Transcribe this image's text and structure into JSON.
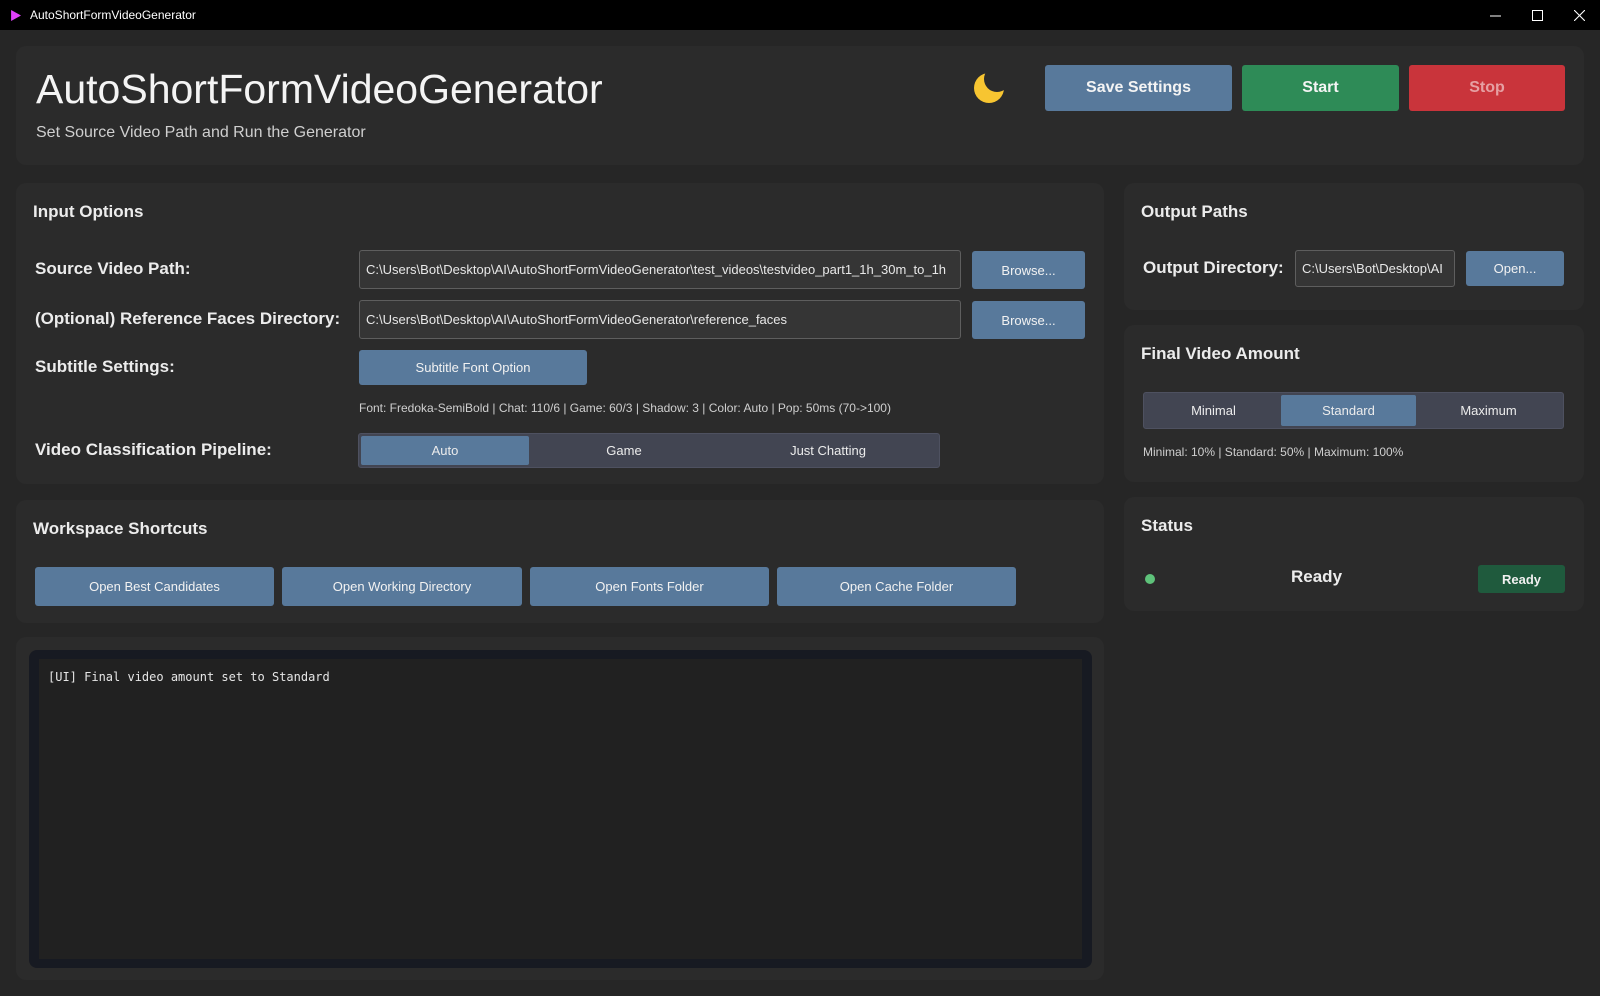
{
  "window": {
    "title": "AutoShortFormVideoGenerator",
    "controls": [
      "minimize-icon",
      "maximize-icon",
      "close-icon"
    ]
  },
  "header": {
    "title": "AutoShortFormVideoGenerator",
    "subtitle": "Set Source Video Path and Run the Generator",
    "theme_icon": "moon-icon",
    "save_label": "Save Settings",
    "start_label": "Start",
    "stop_label": "Stop"
  },
  "colors": {
    "save": "#58799b",
    "start": "#2e8b57",
    "stop": "#c9343b",
    "status_dot": "#5ec27a",
    "status_badge": "#1f5a3d"
  },
  "input_options": {
    "title": "Input Options",
    "source_label": "Source Video Path:",
    "source_value": "C:\\Users\\Bot\\Desktop\\AI\\AutoShortFormVideoGenerator\\test_videos\\testvideo_part1_1h_30m_to_1h",
    "browse_label": "Browse...",
    "faces_label": "(Optional) Reference Faces Directory:",
    "faces_value": "C:\\Users\\Bot\\Desktop\\AI\\AutoShortFormVideoGenerator\\reference_faces",
    "subtitle_label": "Subtitle Settings:",
    "subtitle_button": "Subtitle Font Option",
    "subtitle_info": "Font: Fredoka-SemiBold | Chat: 110/6 | Game: 60/3 | Shadow: 3 | Color: Auto | Pop: 50ms (70->100)",
    "pipeline_label": "Video Classification Pipeline:",
    "pipeline_options": [
      "Auto",
      "Game",
      "Just Chatting"
    ],
    "pipeline_selected": "Auto"
  },
  "output_paths": {
    "title": "Output Paths",
    "dir_label": "Output Directory:",
    "dir_value": "C:\\Users\\Bot\\Desktop\\AI",
    "open_label": "Open..."
  },
  "final_amount": {
    "title": "Final Video Amount",
    "options": [
      "Minimal",
      "Standard",
      "Maximum"
    ],
    "selected": "Standard",
    "info": "Minimal: 10% | Standard: 50% | Maximum: 100%"
  },
  "shortcuts": {
    "title": "Workspace Shortcuts",
    "buttons": [
      "Open Best Candidates",
      "Open Working Directory",
      "Open Fonts Folder",
      "Open Cache Folder"
    ]
  },
  "status": {
    "title": "Status",
    "text": "Ready",
    "badge": "Ready"
  },
  "log": {
    "lines": [
      "[UI] Final video amount set to Standard"
    ]
  }
}
